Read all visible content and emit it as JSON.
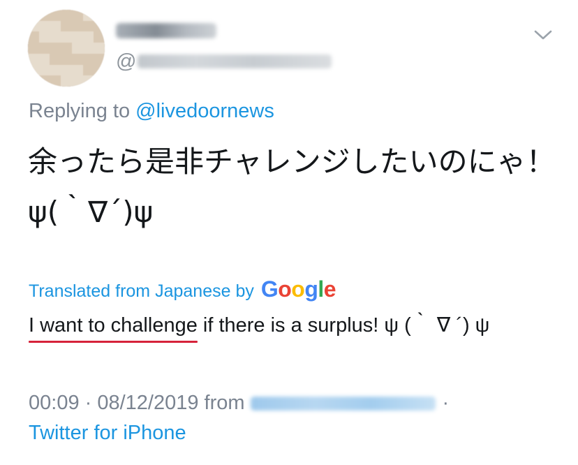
{
  "tweet": {
    "reply_prefix": "Replying to",
    "reply_to": "@livedoornews",
    "handle_prefix": "@",
    "text": "余ったら是非チャレンジしたいのにゃ！ ψ(｀∇´)ψ",
    "translated_label": "Translated from Japanese by",
    "translation_provider": "Google",
    "translation_underlined": "I want to challenge",
    "translation_rest": " if there is a surplus! ψ (｀ ∇ ´) ψ",
    "timestamp": "00:09 · 08/12/2019 from",
    "separator": "·",
    "client": "Twitter for iPhone"
  },
  "icons": {
    "menu": "chevron-down-icon"
  },
  "colors": {
    "link": "#1b95e0",
    "secondary_text": "#7a8390",
    "primary_text": "#14171a",
    "annotation_underline": "#d6223a"
  }
}
